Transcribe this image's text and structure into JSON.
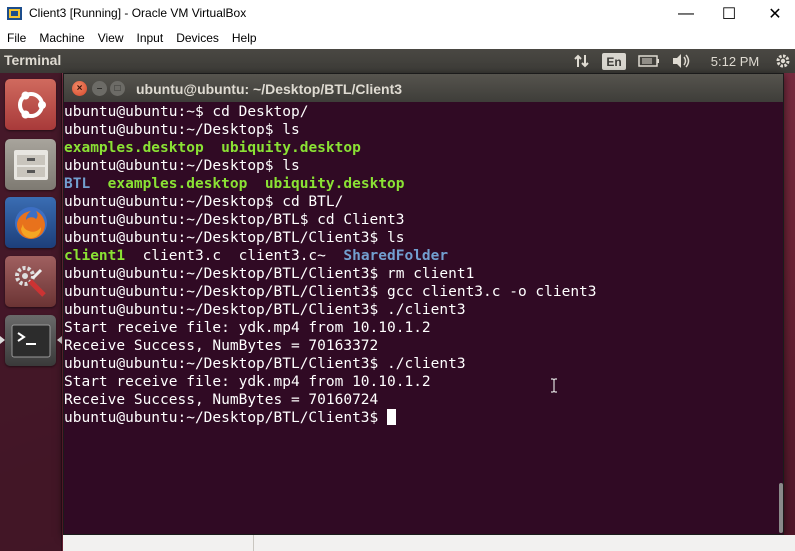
{
  "window": {
    "title": "Client3 [Running] - Oracle VM VirtualBox",
    "app_icon": "virtualbox-icon",
    "controls": {
      "minimize": "—",
      "maximize": "☐",
      "close": "✕"
    }
  },
  "vbox_menu": [
    "File",
    "Machine",
    "View",
    "Input",
    "Devices",
    "Help"
  ],
  "ubuntu_panel": {
    "app_name": "Terminal",
    "keyboard_layout": "En",
    "clock": "5:12 PM",
    "icons": [
      "network-arrows-icon",
      "battery-icon",
      "volume-icon",
      "gear-icon"
    ]
  },
  "launcher": {
    "items": [
      "ubuntu-dash-icon",
      "files-icon",
      "firefox-icon",
      "system-settings-icon",
      "terminal-icon"
    ]
  },
  "terminal": {
    "title": "ubuntu@ubuntu: ~/Desktop/BTL/Client3",
    "colors": {
      "background": "#300a24",
      "executable": "#8ae234",
      "directory": "#729fcf",
      "text": "#ffffff"
    },
    "lines": [
      [
        {
          "t": "ubuntu@ubuntu:~$ cd Desktop/",
          "c": "plain"
        }
      ],
      [
        {
          "t": "ubuntu@ubuntu:~/Desktop$ ls",
          "c": "plain"
        }
      ],
      [
        {
          "t": "examples.desktop",
          "c": "exe"
        },
        {
          "t": "  ",
          "c": "plain"
        },
        {
          "t": "ubiquity.desktop",
          "c": "exe"
        }
      ],
      [
        {
          "t": "ubuntu@ubuntu:~/Desktop$ ls",
          "c": "plain"
        }
      ],
      [
        {
          "t": "BTL",
          "c": "dir"
        },
        {
          "t": "  ",
          "c": "plain"
        },
        {
          "t": "examples.desktop",
          "c": "exe"
        },
        {
          "t": "  ",
          "c": "plain"
        },
        {
          "t": "ubiquity.desktop",
          "c": "exe"
        }
      ],
      [
        {
          "t": "ubuntu@ubuntu:~/Desktop$ cd BTL/",
          "c": "plain"
        }
      ],
      [
        {
          "t": "ubuntu@ubuntu:~/Desktop/BTL$ cd Client3",
          "c": "plain"
        }
      ],
      [
        {
          "t": "ubuntu@ubuntu:~/Desktop/BTL/Client3$ ls",
          "c": "plain"
        }
      ],
      [
        {
          "t": "client1",
          "c": "exe"
        },
        {
          "t": "  client3.c  client3.c~  ",
          "c": "plain"
        },
        {
          "t": "SharedFolder",
          "c": "dir"
        }
      ],
      [
        {
          "t": "ubuntu@ubuntu:~/Desktop/BTL/Client3$ rm client1",
          "c": "plain"
        }
      ],
      [
        {
          "t": "ubuntu@ubuntu:~/Desktop/BTL/Client3$ gcc client3.c -o client3",
          "c": "plain"
        }
      ],
      [
        {
          "t": "ubuntu@ubuntu:~/Desktop/BTL/Client3$ ./client3",
          "c": "plain"
        }
      ],
      [
        {
          "t": "Start receive file: ydk.mp4 from 10.10.1.2",
          "c": "plain"
        }
      ],
      [
        {
          "t": "Receive Success, NumBytes = 70163372",
          "c": "plain"
        }
      ],
      [
        {
          "t": "ubuntu@ubuntu:~/Desktop/BTL/Client3$ ./client3",
          "c": "plain"
        }
      ],
      [
        {
          "t": "Start receive file: ydk.mp4 from 10.10.1.2",
          "c": "plain"
        }
      ],
      [
        {
          "t": "Receive Success, NumBytes = 70160724",
          "c": "plain"
        }
      ],
      [
        {
          "t": "ubuntu@ubuntu:~/Desktop/BTL/Client3$ ",
          "c": "plain"
        }
      ]
    ]
  }
}
